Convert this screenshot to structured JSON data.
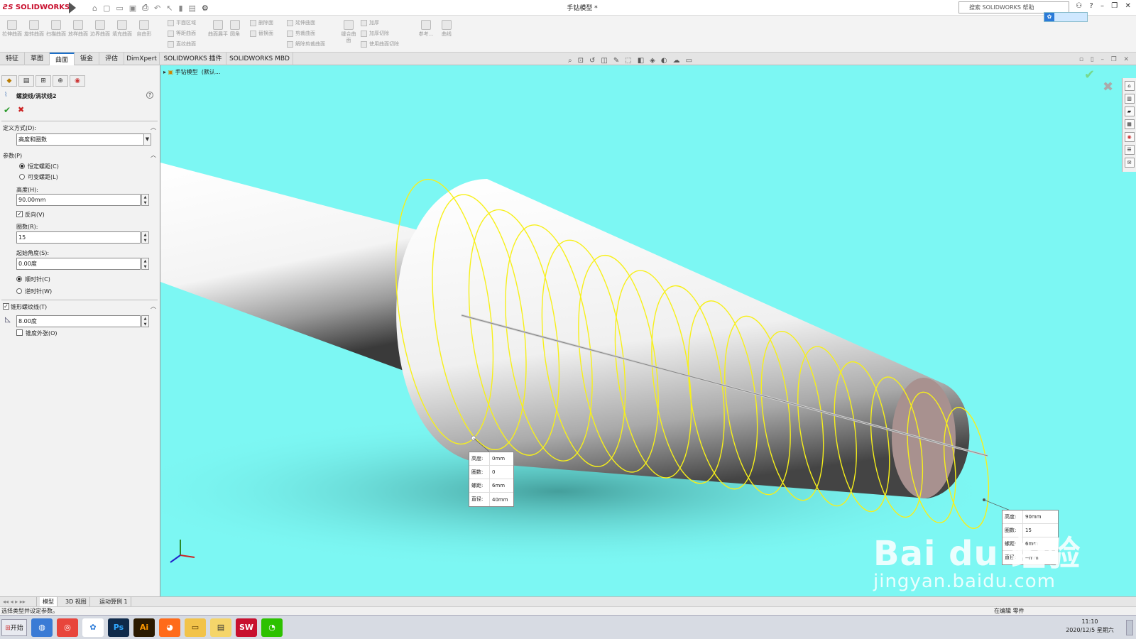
{
  "app": {
    "logo_text": "SOLIDWORKS",
    "document_title": "手钻模型 *",
    "search_placeholder": "搜索 SOLIDWORKS 帮助"
  },
  "ribbon": {
    "big_buttons": [
      "拉伸曲面",
      "旋转曲面",
      "扫描曲面",
      "放样曲面",
      "边界曲面",
      "填充曲面",
      "自由形",
      "曲面展平",
      "圆角"
    ],
    "group1": [
      "平面区域",
      "等距曲面",
      "直纹曲面"
    ],
    "group2": [
      "删除面",
      "替换面"
    ],
    "group3": [
      "延伸曲面",
      "剪裁曲面",
      "解除剪裁曲面"
    ],
    "knit": "缝合曲面",
    "group4": [
      "加厚",
      "加厚切除",
      "使用曲面切除"
    ],
    "ref": "参考...",
    "curve": "曲线"
  },
  "tabs": [
    {
      "label": "特征"
    },
    {
      "label": "草图"
    },
    {
      "label": "曲面",
      "active": true
    },
    {
      "label": "钣金"
    },
    {
      "label": "评估"
    },
    {
      "label": "DimXpert"
    },
    {
      "label": "SOLIDWORKS 插件"
    },
    {
      "label": "SOLIDWORKS MBD"
    }
  ],
  "panel": {
    "title": "螺旋线/涡状线2",
    "definition_label": "定义方式(D):",
    "definition_value": "高度和圈数",
    "params_label": "参数(P)",
    "constant_pitch": "恒定螺距(C)",
    "variable_pitch": "可变螺距(L)",
    "height_label": "高度(H):",
    "height_value": "90.00mm",
    "reverse_label": "反向(V)",
    "revolutions_label": "圈数(R):",
    "revolutions_value": "15",
    "start_angle_label": "起始角度(S):",
    "start_angle_value": "0.00度",
    "clockwise": "顺时针(C)",
    "counterclockwise": "逆时针(W)",
    "taper_label": "锥形螺纹线(T)",
    "taper_value": "8.00度",
    "taper_outward": "锥度外张(O)"
  },
  "tree": {
    "root": "手钻模型",
    "config": "(默认..."
  },
  "callout_start": [
    {
      "k": "高度:",
      "v": "0mm"
    },
    {
      "k": "圈数:",
      "v": "0"
    },
    {
      "k": "螺距:",
      "v": "6mm"
    },
    {
      "k": "直径:",
      "v": "40mm"
    }
  ],
  "callout_end": [
    {
      "k": "高度:",
      "v": "90mm"
    },
    {
      "k": "圈数:",
      "v": "15"
    },
    {
      "k": "螺距:",
      "v": "6mm"
    },
    {
      "k": "直径:",
      "v": "--mm"
    }
  ],
  "watermark": {
    "line1": "Bai du 经验",
    "line2": "jingyan.baidu.com"
  },
  "bottom_tabs": [
    {
      "label": "模型",
      "active": true
    },
    {
      "label": "3D 视图"
    },
    {
      "label": "运动算例 1"
    }
  ],
  "status": {
    "message": "选择类型并设定参数。",
    "editing": "在编辑 零件"
  },
  "taskbar": {
    "start": "开始",
    "apps": [
      "QQ浏览器",
      "Chrome",
      "百度网盘",
      "Ps",
      "Ai",
      "Firefox",
      "资源管理器",
      "便签",
      "SW",
      "微信"
    ],
    "time": "11:10",
    "date": "2020/12/5 星期六"
  }
}
